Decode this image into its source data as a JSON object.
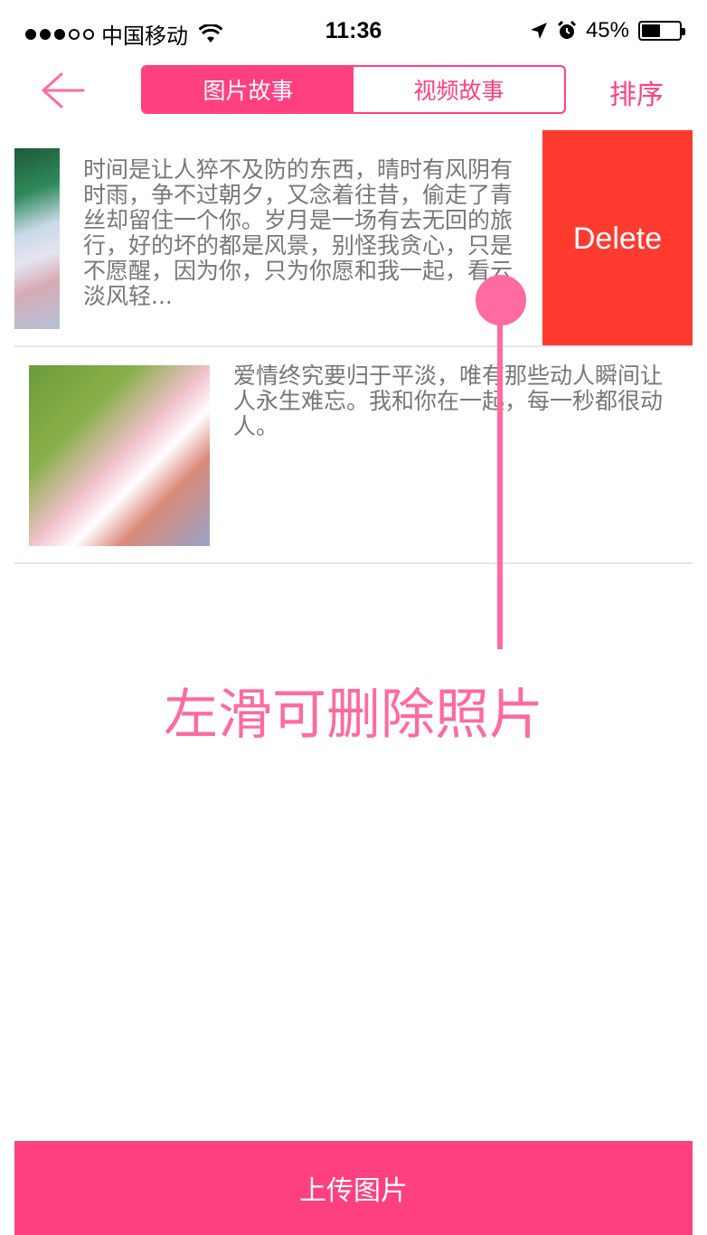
{
  "status_bar": {
    "carrier": "中国移动",
    "time": "11:36",
    "battery": "45%"
  },
  "nav": {
    "tabs": [
      {
        "label": "图片故事",
        "active": true
      },
      {
        "label": "视频故事",
        "active": false
      }
    ],
    "sort_label": "排序"
  },
  "stories": [
    {
      "text": "时间是让人猝不及防的东西，晴时有风阴有时雨，争不过朝夕，又念着往昔，偷走了青丝却留住一个你。岁月是一场有去无回的旅行，好的坏的都是风景，别怪我贪心，只是不愿醒，因为你，只为你愿和我一起，看云淡风轻..."
    },
    {
      "text": "爱情终究要归于平淡，唯有那些动人瞬间让人永生难忘。我和你在一起，每一秒都很动人。"
    }
  ],
  "delete_label": "Delete",
  "hint_text": "左滑可删除照片",
  "upload_label": "上传图片",
  "colors": {
    "accent": "#ff4080",
    "delete": "#ff3b30",
    "hint": "#ff6aa0"
  }
}
